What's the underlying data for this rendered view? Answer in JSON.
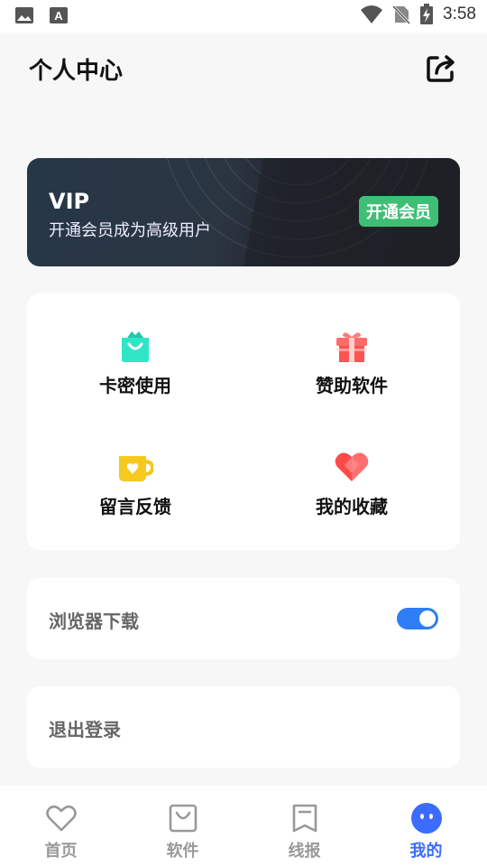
{
  "status_bar": {
    "time": "3:58",
    "icons": [
      "image-icon",
      "text-a-icon",
      "wifi-icon",
      "no-sim-icon",
      "battery-charging-icon"
    ]
  },
  "header": {
    "title": "个人中心",
    "share_icon": "share-icon"
  },
  "vip": {
    "title": "VIP",
    "subtitle": "开通会员成为高级用户",
    "button_label": "开通会员",
    "button_color": "#3fbf76"
  },
  "grid": {
    "items": [
      {
        "label": "卡密使用",
        "icon": "shopping-bag-icon",
        "color": "#2ee0c0"
      },
      {
        "label": "赞助软件",
        "icon": "gift-icon",
        "color": "#ff5c5c"
      },
      {
        "label": "留言反馈",
        "icon": "mug-icon",
        "color": "#f5c518"
      },
      {
        "label": "我的收藏",
        "icon": "heart-icon",
        "color": "#ff3b3b"
      }
    ]
  },
  "settings": {
    "browser_download_label": "浏览器下载",
    "browser_download_enabled": true,
    "logout_label": "退出登录"
  },
  "bottom_nav": {
    "items": [
      {
        "label": "首页",
        "icon": "heart-outline-icon"
      },
      {
        "label": "软件",
        "icon": "bag-outline-icon"
      },
      {
        "label": "线报",
        "icon": "bookmark-outline-icon"
      },
      {
        "label": "我的",
        "icon": "face-icon",
        "active": true
      }
    ],
    "accent_color": "#3b6cff"
  }
}
